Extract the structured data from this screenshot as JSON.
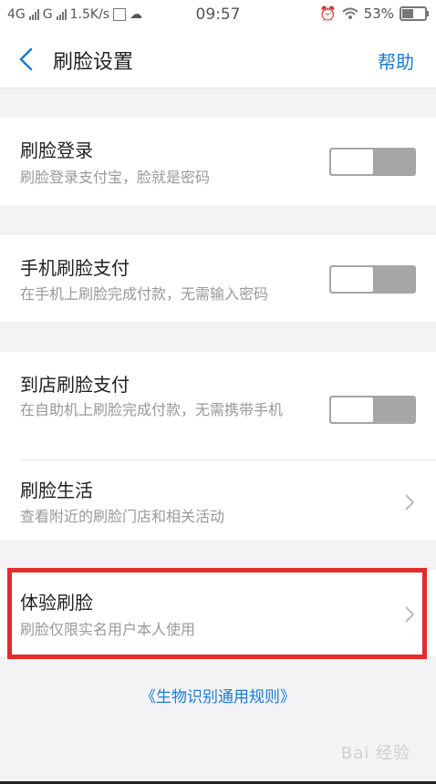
{
  "status_bar": {
    "net1": "4G",
    "net2": "G",
    "speed": "1.5K/s",
    "time": "09:57",
    "battery": "53%",
    "battery_level": 0.53
  },
  "nav": {
    "title": "刷脸设置",
    "help": "帮助"
  },
  "items": [
    {
      "title": "刷脸登录",
      "subtitle": "刷脸登录支付宝，脸就是密码",
      "control": "toggle",
      "on": false
    },
    {
      "title": "手机刷脸支付",
      "subtitle": "在手机上刷脸完成付款，无需输入密码",
      "control": "toggle",
      "on": false
    },
    {
      "title": "到店刷脸支付",
      "subtitle": "在自助机上刷脸完成付款，无需携带手机",
      "control": "toggle",
      "on": false
    },
    {
      "title": "刷脸生活",
      "subtitle": "查看附近的刷脸门店和相关活动",
      "control": "chevron"
    },
    {
      "title": "体验刷脸",
      "subtitle": "刷脸仅限实名用户本人使用",
      "control": "chevron"
    }
  ],
  "footer": {
    "link": "《生物识别通用规则》"
  },
  "watermark": "Bai 经验",
  "colors": {
    "accent": "#1a7bd6",
    "highlight": "#e52b2b",
    "toggle_off": "#a6a6a6"
  }
}
